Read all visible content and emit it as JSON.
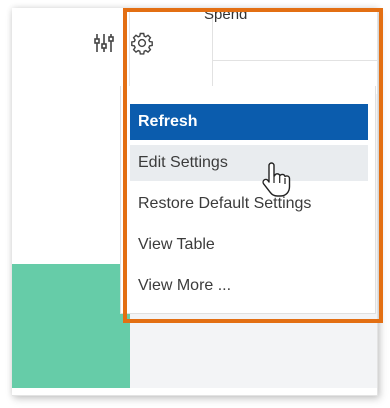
{
  "header": {
    "spend_label": "Spend"
  },
  "toolbar": {
    "filter_icon": "filter-sliders-icon",
    "settings_icon": "gear-icon"
  },
  "menu": {
    "items": [
      {
        "label": "Refresh",
        "state": "selected"
      },
      {
        "label": "Edit Settings",
        "state": "hovered"
      },
      {
        "label": "Restore Default Settings",
        "state": "normal"
      },
      {
        "label": "View Table",
        "state": "normal"
      },
      {
        "label": "View More ...",
        "state": "normal"
      }
    ]
  },
  "colors": {
    "highlight_frame": "#e36f13",
    "selected_item_bg": "#0b5cad",
    "hover_item_bg": "#e9ecef",
    "chart_bar": "#66cca8"
  }
}
